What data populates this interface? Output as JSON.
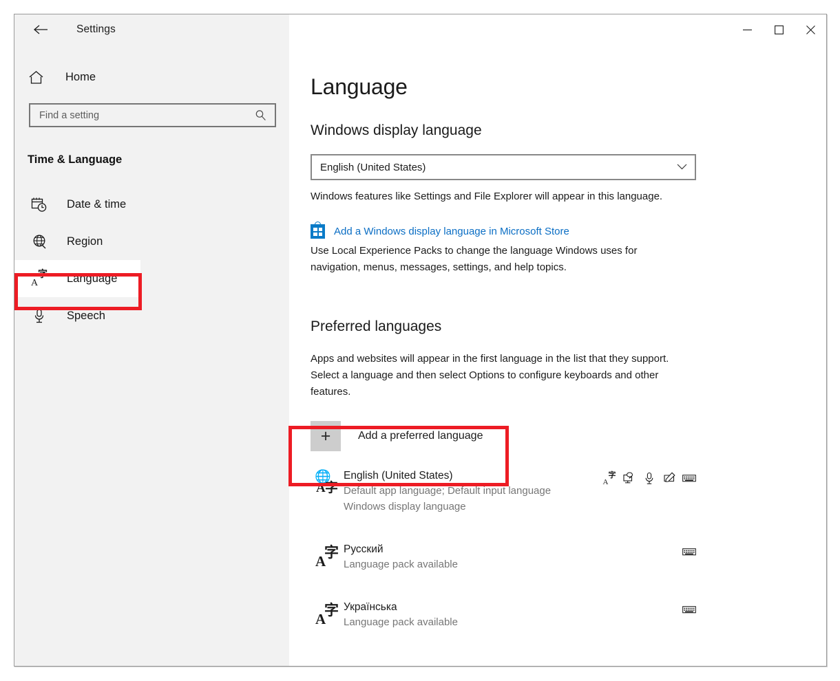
{
  "window": {
    "app_title": "Settings",
    "back_icon": "back-arrow-icon",
    "minimize_label": "—",
    "maximize_label": "☐",
    "close_label": "✕"
  },
  "sidebar": {
    "home_label": "Home",
    "home_icon": "home-icon",
    "search": {
      "placeholder": "Find a setting",
      "value": "",
      "icon": "search-icon"
    },
    "group_heading": "Time & Language",
    "items": [
      {
        "label": "Date & time",
        "icon": "calendar-clock-icon",
        "selected": false
      },
      {
        "label": "Region",
        "icon": "globe-icon",
        "selected": false
      },
      {
        "label": "Language",
        "icon": "language-aji-icon",
        "selected": true
      },
      {
        "label": "Speech",
        "icon": "microphone-icon",
        "selected": false
      }
    ]
  },
  "main": {
    "page_title": "Language",
    "display_section": {
      "title": "Windows display language",
      "dropdown": {
        "value": "English (United States)",
        "chevron_icon": "chevron-down-icon"
      },
      "note": "Windows features like Settings and File Explorer will appear in this language.",
      "store_link": {
        "text": "Add a Windows display language in Microsoft Store",
        "icon": "microsoft-store-icon",
        "color": "#0b6ec4"
      },
      "lep_note": "Use Local Experience Packs to change the language Windows uses for navigation, menus, messages, settings, and help topics."
    },
    "preferred_section": {
      "title": "Preferred languages",
      "note": "Apps and websites will appear in the first language in the list that they support. Select a language and then select Options to configure keyboards and other features.",
      "add_button": {
        "label": "Add a preferred language",
        "icon": "plus-icon"
      },
      "languages": [
        {
          "name": "English (United States)",
          "sub1": "Default app language; Default input language",
          "sub2": "Windows display language",
          "icon": "globe-language-icon",
          "features": [
            "language-pack-icon",
            "display-language-icon",
            "speech-microphone-icon",
            "handwriting-pen-icon",
            "keyboard-icon"
          ]
        },
        {
          "name": "Русский",
          "sub1": "Language pack available",
          "sub2": "",
          "icon": "language-aji-icon",
          "features": [
            "keyboard-icon"
          ]
        },
        {
          "name": "Українська",
          "sub1": "Language pack available",
          "sub2": "",
          "icon": "language-aji-icon",
          "features": [
            "keyboard-icon"
          ]
        }
      ]
    }
  },
  "annotations": {
    "accent_color": "#ed1c24",
    "boxes": [
      "sidebar-language-item",
      "add-preferred-language-button"
    ]
  }
}
